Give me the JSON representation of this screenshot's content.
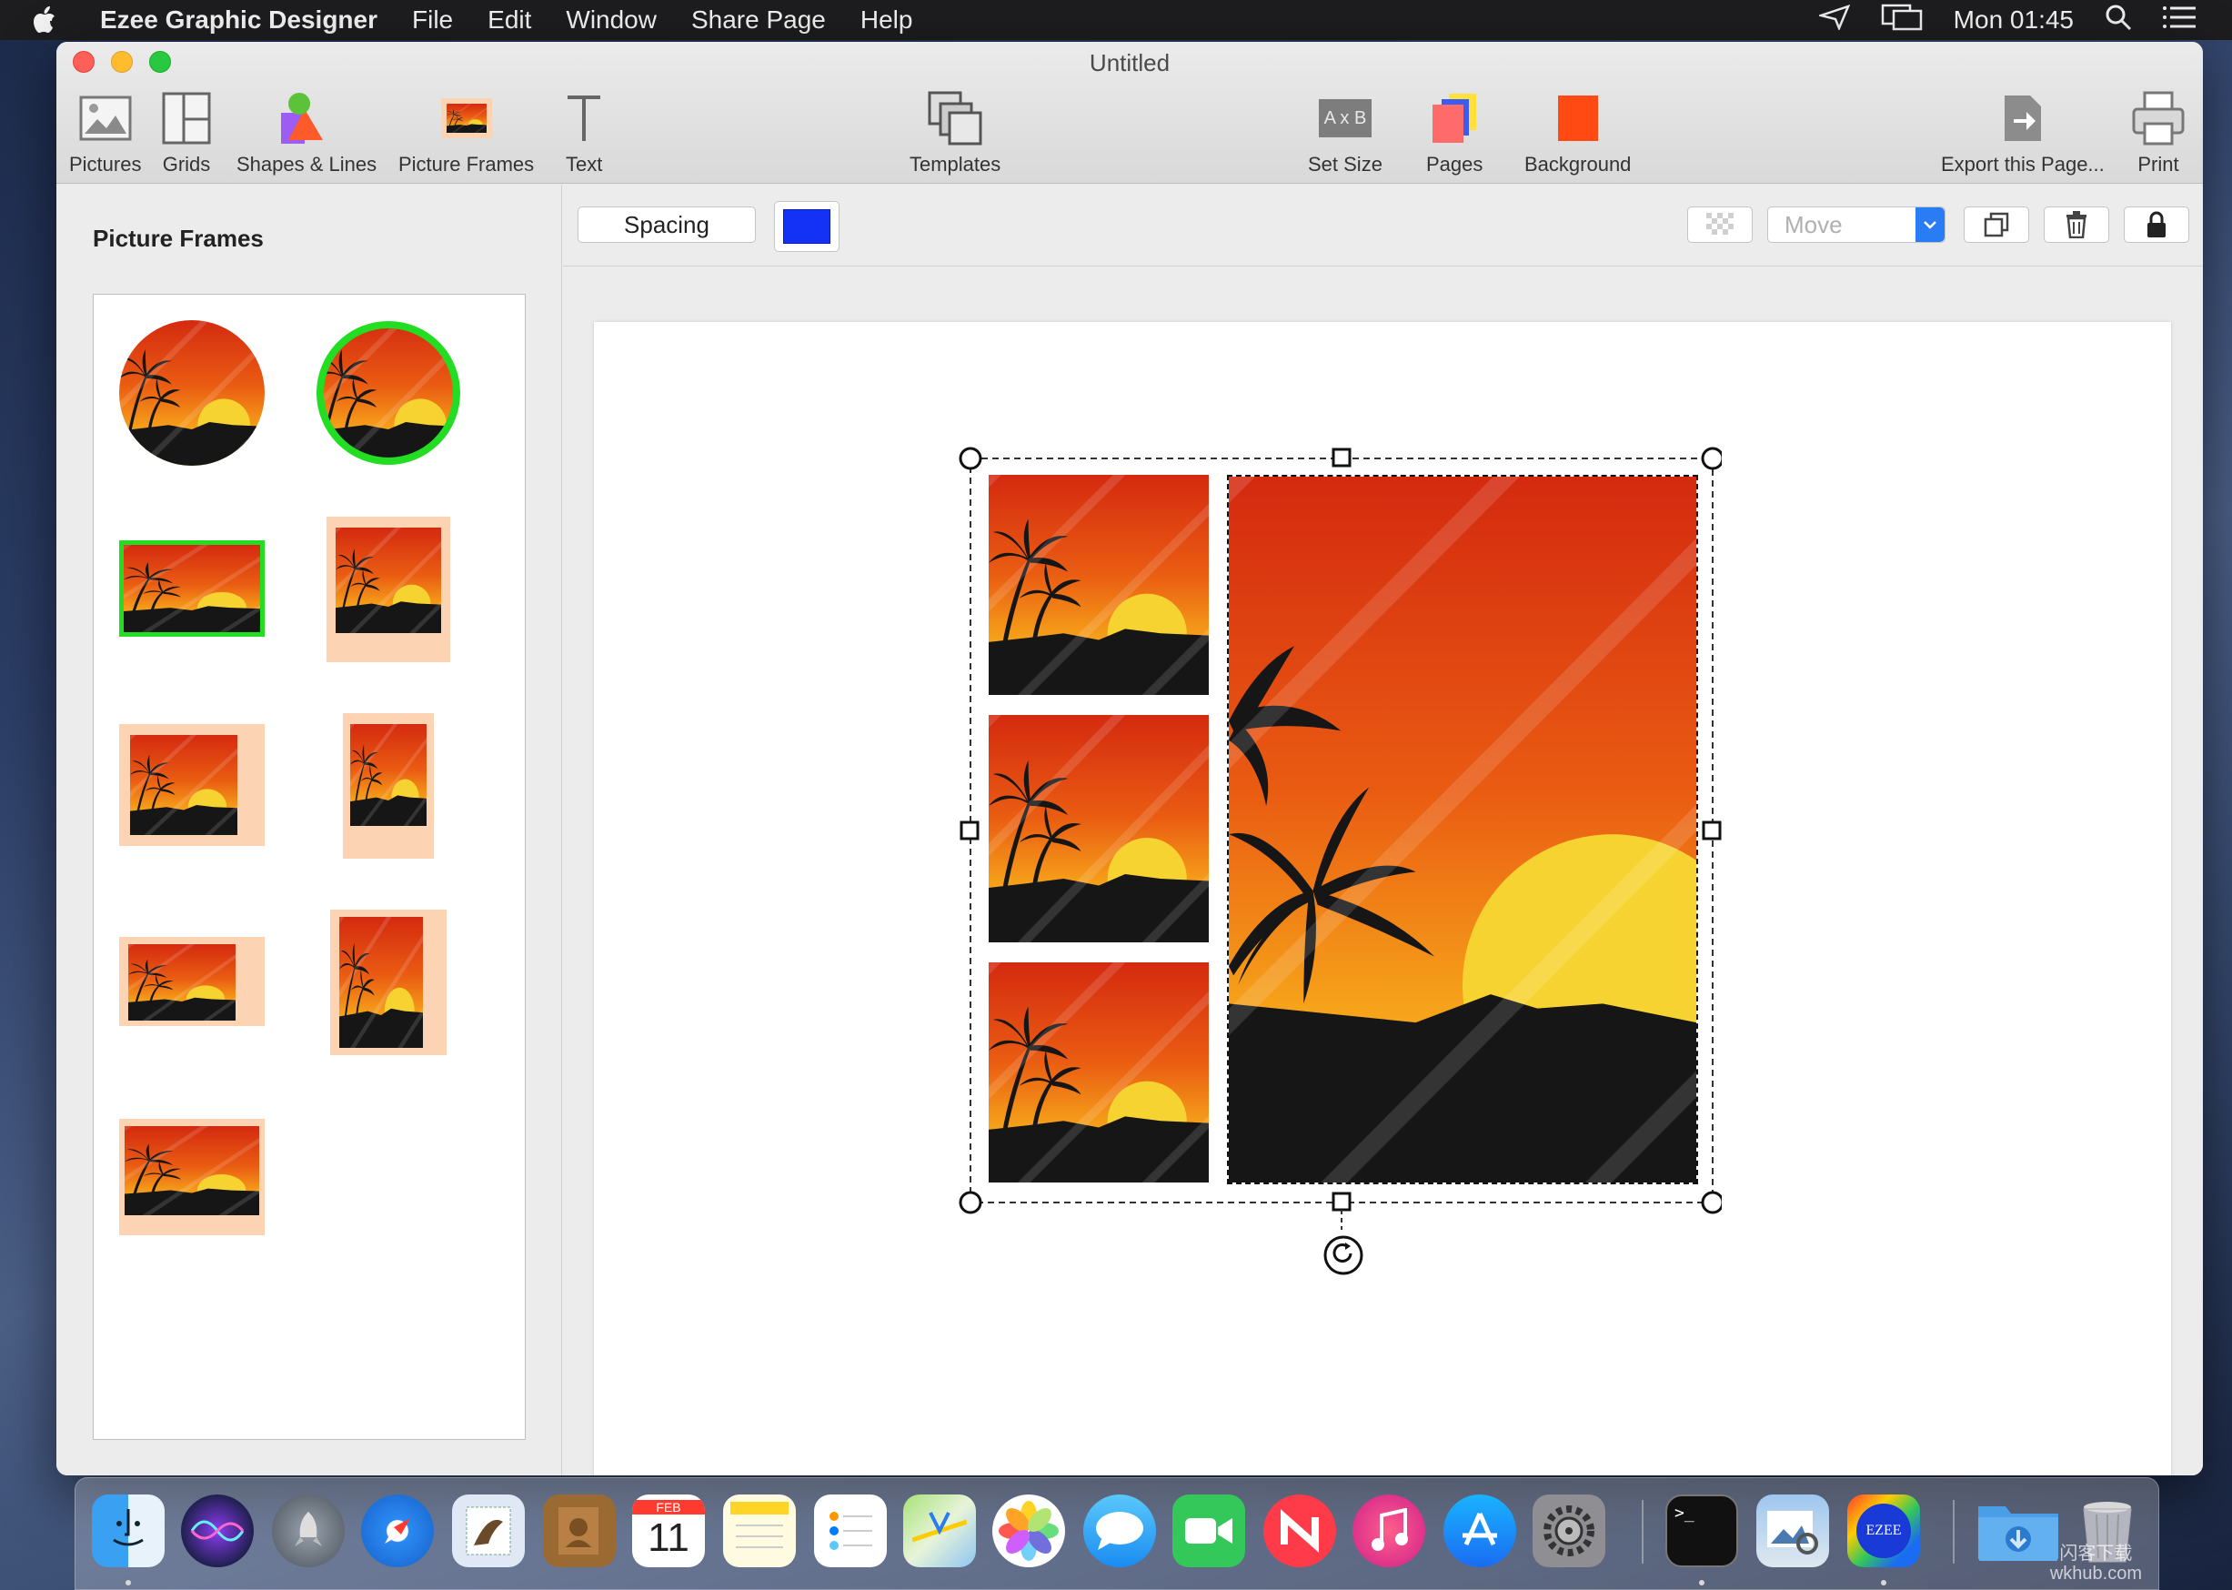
{
  "menubar": {
    "app_name": "Ezee Graphic Designer",
    "items": [
      "File",
      "Edit",
      "Window",
      "Share Page",
      "Help"
    ],
    "clock": "Mon 01:45"
  },
  "window": {
    "title": "Untitled"
  },
  "toolbar": {
    "pictures": "Pictures",
    "grids": "Grids",
    "shapes_lines": "Shapes & Lines",
    "picture_frames": "Picture Frames",
    "text": "Text",
    "templates": "Templates",
    "set_size": "Set Size",
    "set_size_glyph": "A x B",
    "pages": "Pages",
    "background": "Background",
    "export": "Export this Page...",
    "print": "Print"
  },
  "sidebar": {
    "title": "Picture Frames",
    "frame_styles": [
      "circle-plain",
      "circle-green-border",
      "rect-green-border",
      "peach-mat-portrait",
      "peach-mat-landscape",
      "peach-mat-tall",
      "peach-mat-wide",
      "peach-mat-tall-2",
      "peach-mat-large"
    ]
  },
  "subbar": {
    "spacing_label": "Spacing",
    "spacing_color": "#1432f5",
    "arrange_value": "Move"
  },
  "colors": {
    "accent_blue": "#2a7cf4",
    "frame_green": "#22dd22",
    "mat_peach": "#fcd4b4",
    "background_swatch": "#ff4a14"
  },
  "dock": {
    "apps": [
      "finder",
      "siri",
      "launchpad",
      "safari",
      "mail",
      "contacts",
      "calendar",
      "notes",
      "reminders",
      "maps",
      "photos",
      "messages",
      "facetime",
      "news",
      "music",
      "app-store",
      "system-preferences",
      "terminal",
      "preview",
      "ezee",
      "downloads",
      "trash"
    ],
    "calendar_month": "FEB",
    "calendar_day": "11",
    "terminal_prompt": ">_",
    "ezee_label": "EZEE"
  },
  "watermark": {
    "line1": "闪客下载",
    "line2": "wkhub.com"
  }
}
